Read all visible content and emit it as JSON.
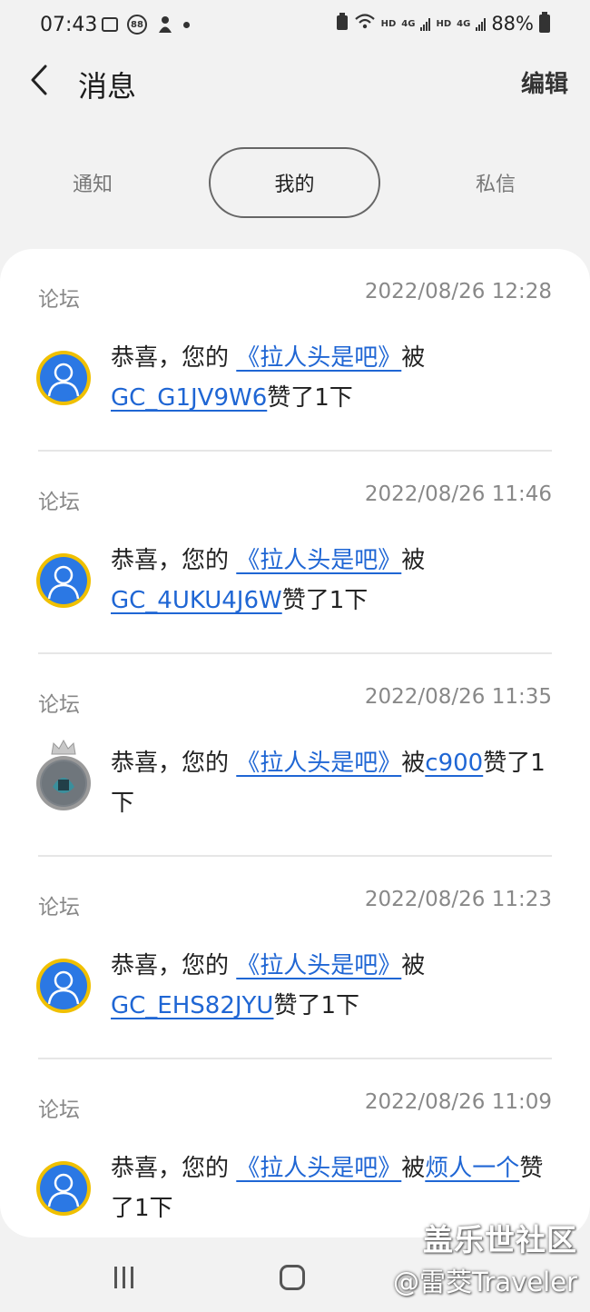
{
  "status_bar": {
    "time": "07:43",
    "battery": "88%",
    "net_label_1": "HD",
    "net_label_2": "4G",
    "net_label_3": "HD",
    "net_label_4": "4G",
    "icon_88": "88"
  },
  "header": {
    "title": "消息",
    "edit_label": "编辑"
  },
  "tabs": {
    "notify": "通知",
    "mine": "我的",
    "dm": "私信"
  },
  "messages": [
    {
      "source": "论坛",
      "time": "2022/08/26 12:28",
      "prefix": "恭喜，您的 ",
      "post": "《拉人头是吧》",
      "mid": "被",
      "user": "GC_G1JV9W6",
      "suffix": "赞了1下"
    },
    {
      "source": "论坛",
      "time": "2022/08/26 11:46",
      "prefix": "恭喜，您的 ",
      "post": "《拉人头是吧》",
      "mid": "被",
      "user": "GC_4UKU4J6W",
      "suffix": "赞了1下"
    },
    {
      "source": "论坛",
      "time": "2022/08/26 11:35",
      "prefix": "恭喜，您的 ",
      "post": "《拉人头是吧》",
      "mid": "被",
      "user": "c900",
      "suffix": "赞了1下"
    },
    {
      "source": "论坛",
      "time": "2022/08/26 11:23",
      "prefix": "恭喜，您的 ",
      "post": "《拉人头是吧》",
      "mid": "被",
      "user": "GC_EHS82JYU",
      "suffix": "赞了1下"
    },
    {
      "source": "论坛",
      "time": "2022/08/26 11:09",
      "prefix": "恭喜，您的 ",
      "post": "《拉人头是吧》",
      "mid": "被",
      "user": "烦人一个",
      "suffix": "赞了1下"
    }
  ],
  "watermark": {
    "line1": "盖乐世社区",
    "line2": "@雷茭Traveler"
  },
  "colors": {
    "link": "#1f66d4",
    "avatar_ring": "#f0c000",
    "avatar_fill": "#2b78e4"
  }
}
